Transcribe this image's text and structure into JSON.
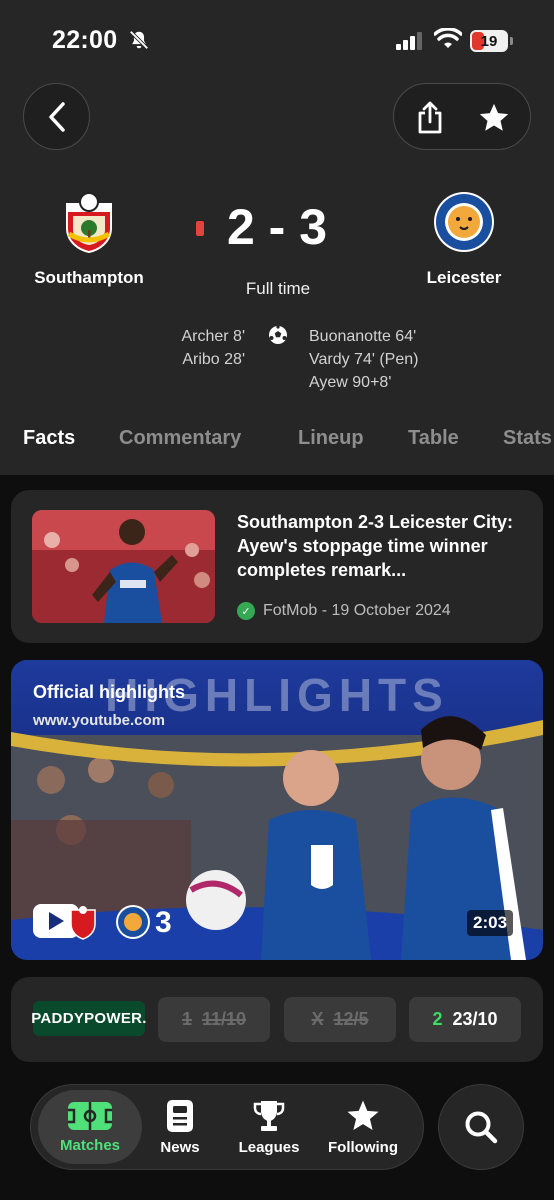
{
  "status_bar": {
    "time": "22:00",
    "battery": "19"
  },
  "match": {
    "home_team": "Southampton",
    "away_team": "Leicester",
    "score": "2 - 3",
    "status": "Full time",
    "home_scorers": [
      "Archer 8'",
      "Aribo 28'"
    ],
    "away_scorers": [
      "Buonanotte 64'",
      "Vardy 74' (Pen)",
      "Ayew 90+8'"
    ]
  },
  "tabs": [
    "Facts",
    "Commentary",
    "Lineup",
    "Table",
    "Stats"
  ],
  "news": {
    "title": "Southampton 2-3 Leicester City: Ayew's stoppage time winner completes remark...",
    "source": "FotMob - 19 October 2024"
  },
  "highlights": {
    "title": "Official highlights",
    "url": "www.youtube.com",
    "banner": "HIGHLIGHTS",
    "score_num": "3",
    "duration": "2:03"
  },
  "odds": {
    "provider": "PADDYPOWER.",
    "home": {
      "label": "1",
      "value": "11/10"
    },
    "draw": {
      "label": "X",
      "value": "12/5"
    },
    "away": {
      "label": "2",
      "value": "23/10"
    }
  },
  "nav": {
    "items": [
      {
        "label": "Matches"
      },
      {
        "label": "News"
      },
      {
        "label": "Leagues"
      },
      {
        "label": "Following"
      }
    ]
  },
  "colors": {
    "accent_green": "#4fe07a",
    "red_card": "#e0443c",
    "surface": "#262626"
  }
}
